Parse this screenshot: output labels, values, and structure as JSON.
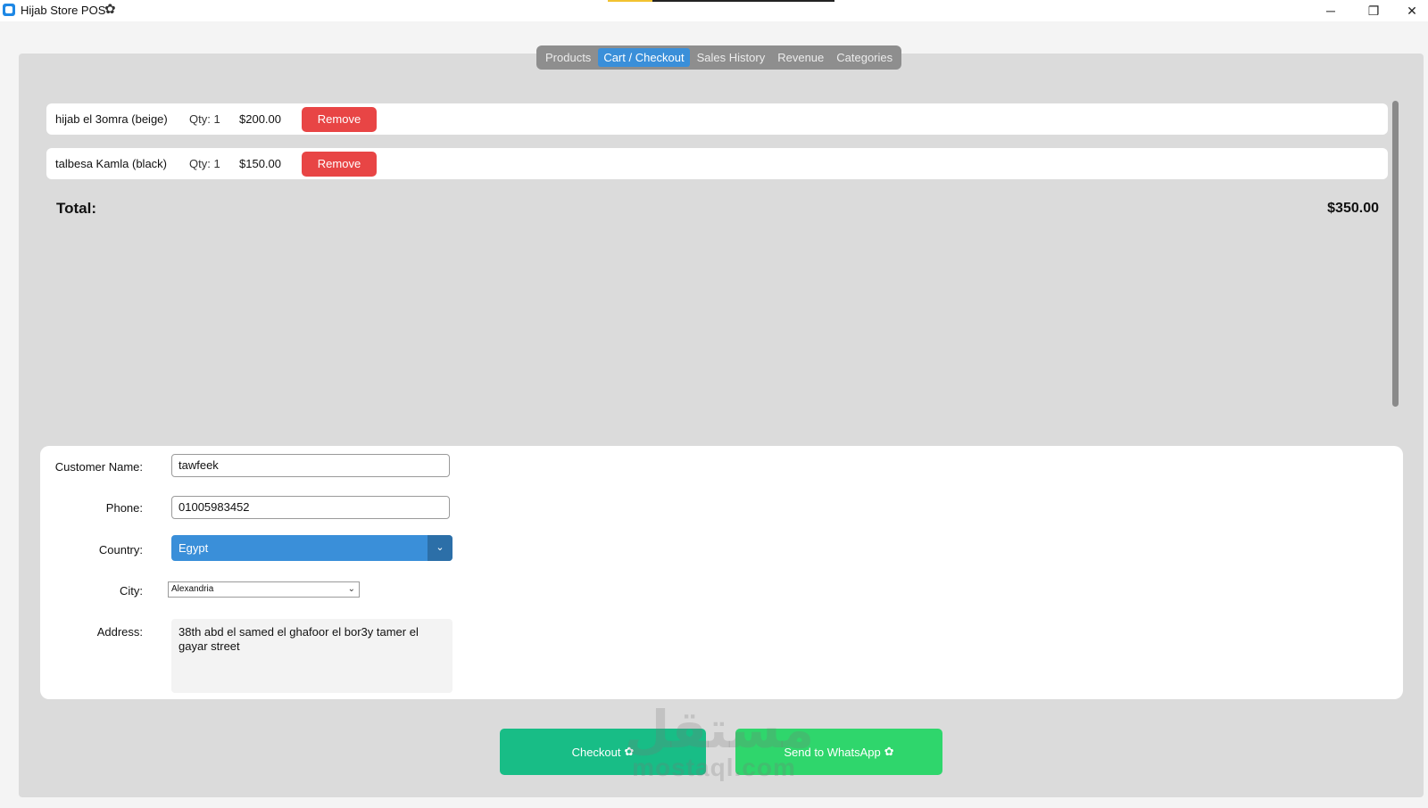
{
  "window": {
    "title": "Hijab Store POS",
    "title_icon": "flower-icon",
    "minimize_glyph": "─",
    "maximize_glyph": "❐",
    "close_glyph": "✕"
  },
  "tabs": [
    {
      "label": "Products",
      "active": false
    },
    {
      "label": "Cart / Checkout",
      "active": true
    },
    {
      "label": "Sales History",
      "active": false
    },
    {
      "label": "Revenue",
      "active": false
    },
    {
      "label": "Categories",
      "active": false
    }
  ],
  "cart": {
    "items": [
      {
        "name": "hijab el 3omra (beige)",
        "qty": "Qty: 1",
        "price": "$200.00",
        "remove_label": "Remove"
      },
      {
        "name": "talbesa Kamla (black)",
        "qty": "Qty: 1",
        "price": "$150.00",
        "remove_label": "Remove"
      }
    ],
    "total_label": "Total:",
    "total_value": "$350.00"
  },
  "form": {
    "customer_name_label": "Customer Name:",
    "customer_name_value": "tawfeek",
    "phone_label": "Phone:",
    "phone_value": "01005983452",
    "country_label": "Country:",
    "country_value": "Egypt",
    "city_label": "City:",
    "city_value": "Alexandria",
    "address_label": "Address:",
    "address_value": "38th abd el samed el ghafoor el bor3y tamer el gayar street"
  },
  "actions": {
    "checkout_label": "Checkout",
    "whatsapp_label": "Send to WhatsApp"
  },
  "watermark": {
    "arabic": "مستقل",
    "latin": "mostaql.com"
  },
  "colors": {
    "accent_blue": "#3a8fd9",
    "remove_red": "#e84545",
    "checkout_green": "#18bd86",
    "whatsapp_green": "#2fd66c"
  }
}
